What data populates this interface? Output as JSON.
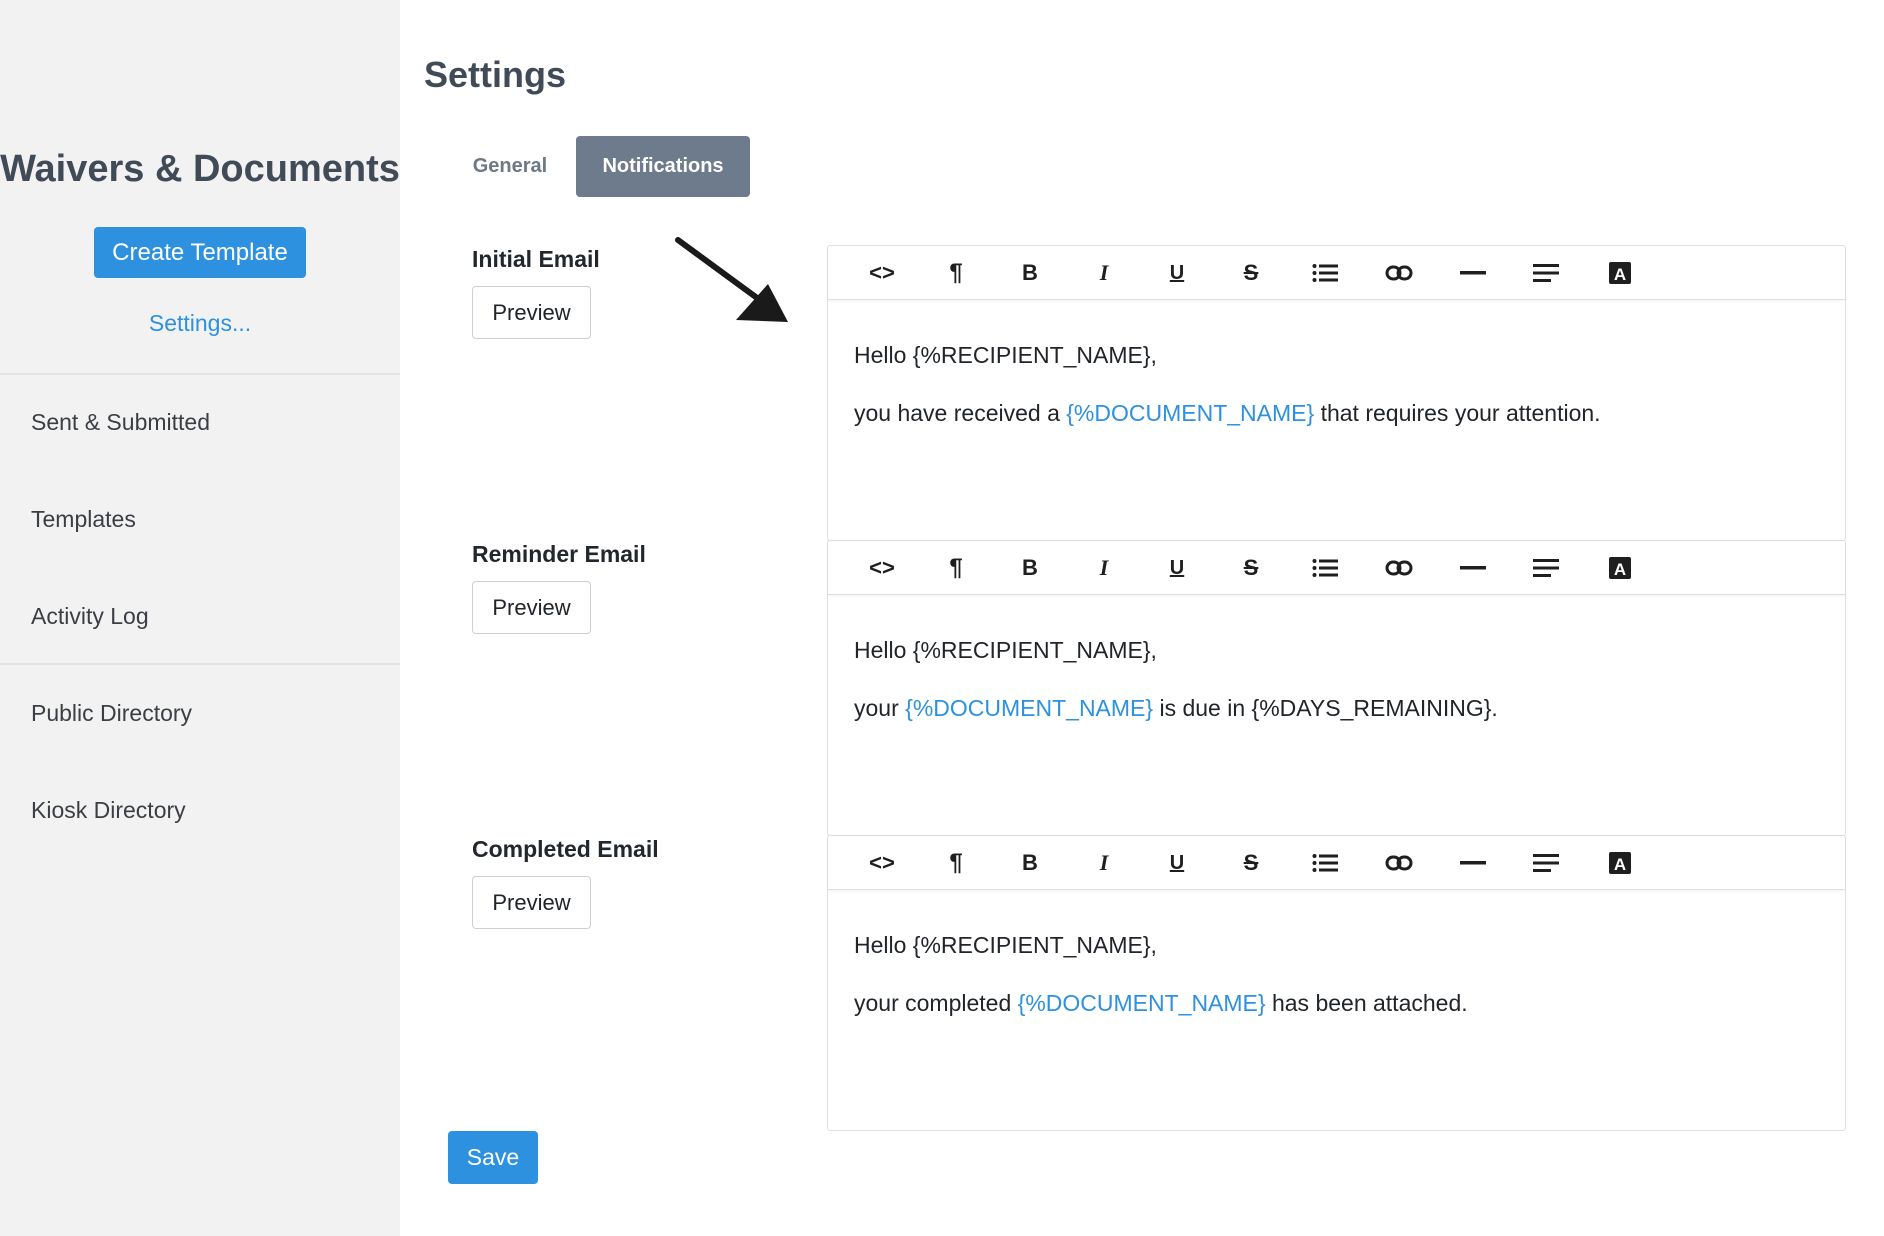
{
  "sidebar": {
    "brand": "Waivers & Documents",
    "create_button": "Create Template",
    "settings_link": "Settings...",
    "items": [
      {
        "label": "Sent & Submitted"
      },
      {
        "label": "Templates"
      },
      {
        "label": "Activity Log"
      },
      {
        "label": "Public Directory"
      },
      {
        "label": "Kiosk Directory"
      }
    ]
  },
  "main": {
    "title": "Settings",
    "tabs": [
      {
        "label": "General",
        "active": false
      },
      {
        "label": "Notifications",
        "active": true
      }
    ],
    "sections": [
      {
        "label": "Initial Email",
        "preview_label": "Preview",
        "line1": "Hello {%RECIPIENT_NAME},",
        "line2_pre": "you have received a ",
        "line2_var": "{%DOCUMENT_NAME}",
        "line2_post": " that requires your attention."
      },
      {
        "label": "Reminder Email",
        "preview_label": "Preview",
        "line1": "Hello {%RECIPIENT_NAME},",
        "line2_pre": "your ",
        "line2_var": "{%DOCUMENT_NAME}",
        "line2_post": " is due in {%DAYS_REMAINING}."
      },
      {
        "label": "Completed Email",
        "preview_label": "Preview",
        "line1": "Hello {%RECIPIENT_NAME},",
        "line2_pre": "your completed ",
        "line2_var": "{%DOCUMENT_NAME}",
        "line2_post": " has been attached."
      }
    ],
    "toolbar_icons": [
      "code-view-icon",
      "paragraph-icon",
      "bold-icon",
      "italic-icon",
      "underline-icon",
      "strikethrough-icon",
      "list-icon",
      "link-icon",
      "horizontal-rule-icon",
      "align-icon",
      "text-color-icon"
    ],
    "save_label": "Save"
  },
  "colors": {
    "accent": "#2d91e0",
    "tab_active": "#6e7b8c",
    "sidebar_bg": "#f2f2f2"
  }
}
